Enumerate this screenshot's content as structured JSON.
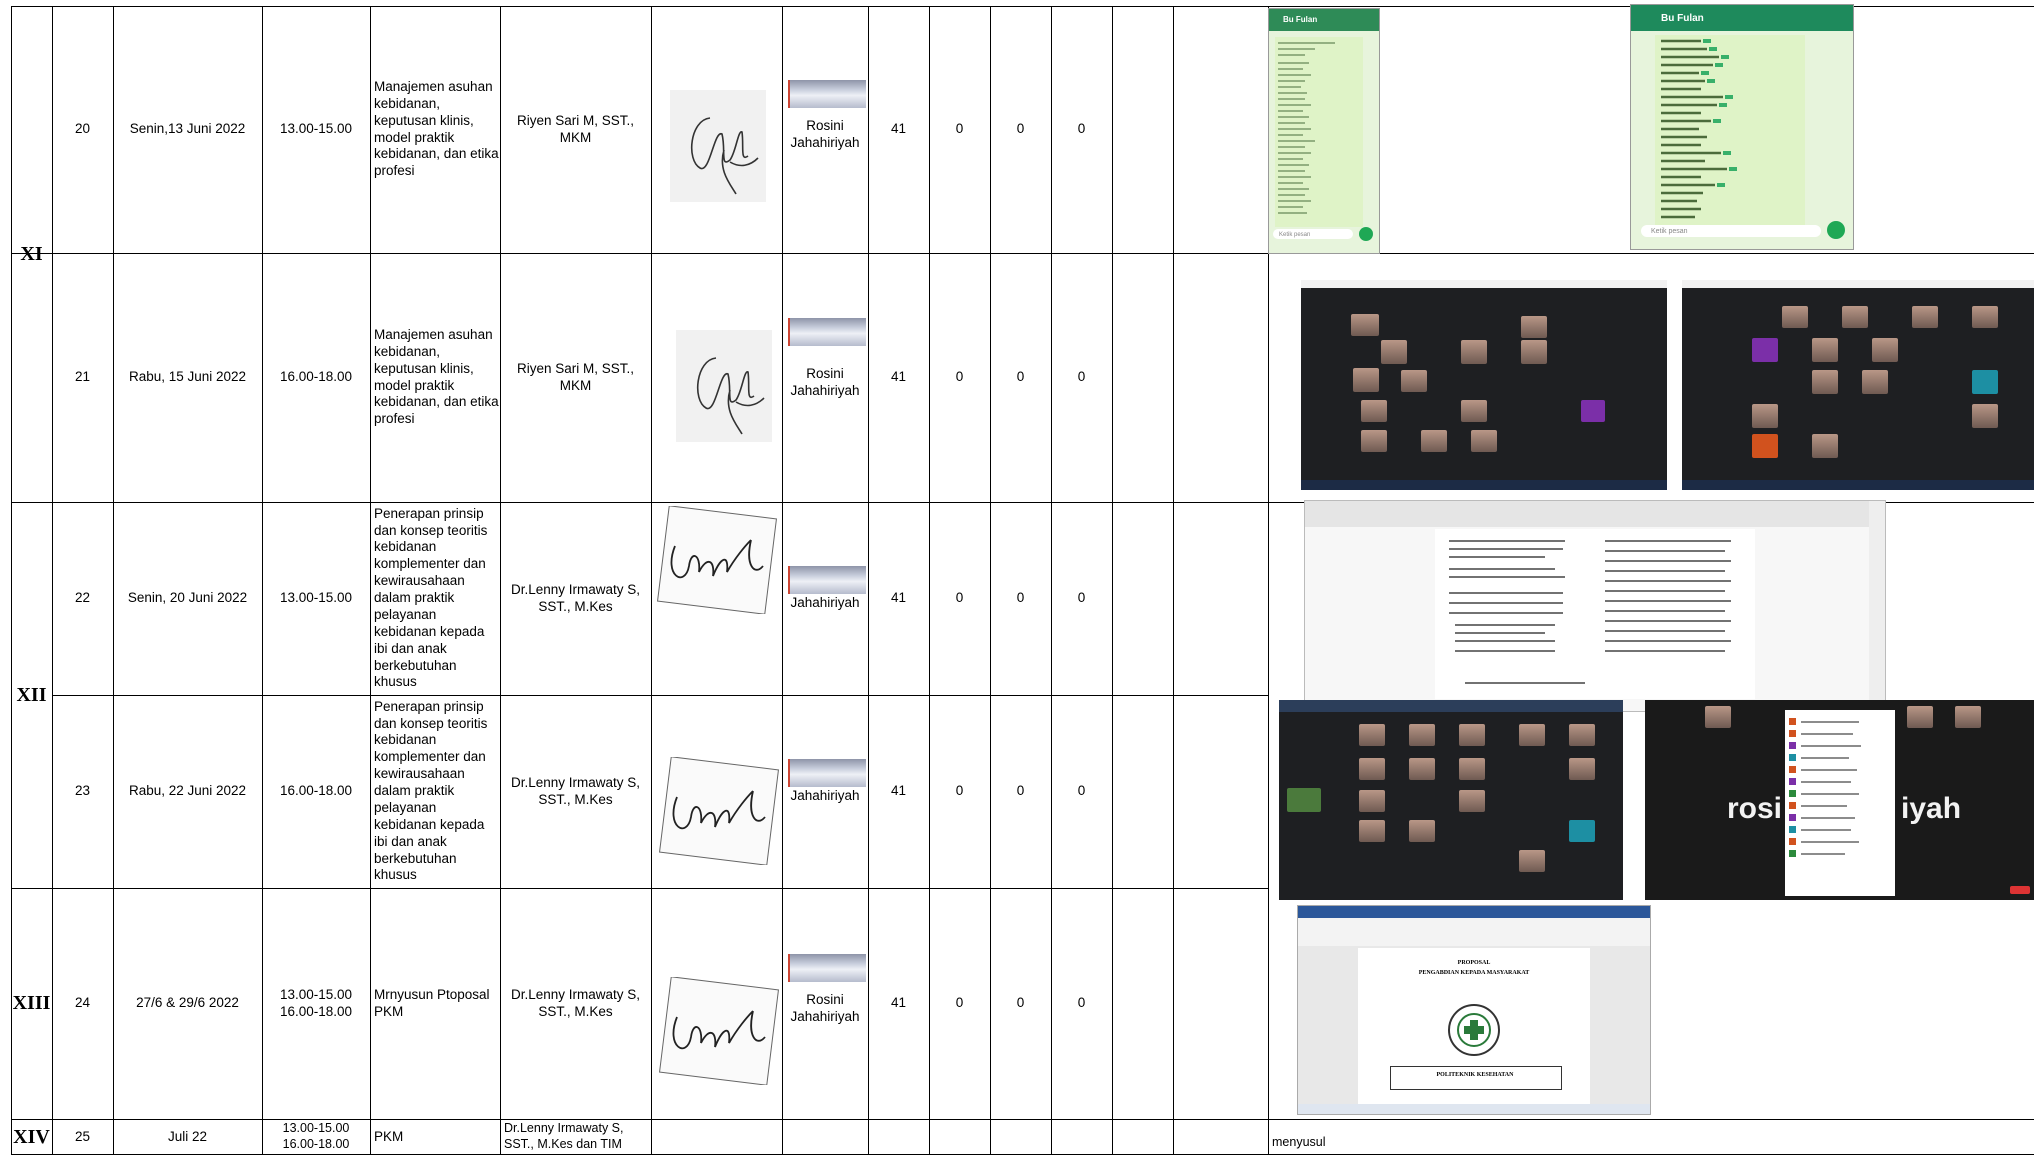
{
  "rows": [
    {
      "no": "20",
      "day": "Senin,13 Juni 2022",
      "time": "13.00-15.00",
      "topic": "Manajemen asuhan kebidanan, keputusan klinis, model praktik kebidanan, dan etika profesi",
      "lecturer": "Riyen Sari M, SST., MKM",
      "witness": "Rosini Jahahiriyah",
      "c1": "41",
      "c2": "0",
      "c3": "0",
      "c4": "0"
    },
    {
      "no": "21",
      "day": "Rabu, 15 Juni 2022",
      "time": "16.00-18.00",
      "topic": "Manajemen asuhan kebidanan, keputusan klinis, model praktik kebidanan, dan etika profesi",
      "lecturer": "Riyen Sari M, SST., MKM",
      "witness": "Rosini Jahahiriyah",
      "c1": "41",
      "c2": "0",
      "c3": "0",
      "c4": "0"
    },
    {
      "no": "22",
      "day": "Senin, 20 Juni 2022",
      "time": "13.00-15.00",
      "topic": "Penerapan prinsip dan konsep teoritis kebidanan komplementer dan kewirausahaan dalam praktik pelayanan kebidanan kepada ibi dan anak berkebutuhan khusus",
      "lecturer": "Dr.Lenny Irmawaty S, SST., M.Kes",
      "witness": "Jahahiriyah",
      "c1": "41",
      "c2": "0",
      "c3": "0",
      "c4": "0"
    },
    {
      "no": "23",
      "day": "Rabu, 22 Juni 2022",
      "time": "16.00-18.00",
      "topic": "Penerapan prinsip dan konsep teoritis kebidanan komplementer dan kewirausahaan dalam praktik pelayanan kebidanan kepada ibi dan anak berkebutuhan khusus",
      "lecturer": "Dr.Lenny Irmawaty S, SST., M.Kes",
      "witness": "Jahahiriyah",
      "c1": "41",
      "c2": "0",
      "c3": "0",
      "c4": "0"
    },
    {
      "no": "24",
      "day": "27/6 & 29/6 2022",
      "time": "13.00-15.00\n16.00-18.00",
      "topic": "Mrnyusun Ptoposal PKM",
      "lecturer": "Dr.Lenny Irmawaty S, SST., M.Kes",
      "witness": "Rosini Jahahiriyah",
      "c1": "41",
      "c2": "0",
      "c3": "0",
      "c4": "0"
    },
    {
      "no": "25",
      "day": "Juli 22",
      "time": "13.00-15.00\n16.00-18.00",
      "topic": "PKM",
      "lecturer": "Dr.Lenny Irmawaty S, SST., M.Kes dan TIM",
      "witness": "",
      "c1": "",
      "c2": "",
      "c3": "",
      "c4": ""
    }
  ],
  "groups": [
    "XI",
    "XII",
    "XIII",
    "XIV"
  ],
  "evidence_note": "menyusul",
  "screens": {
    "chat_left_header": "Bu Fulan",
    "chat_right_header": "Bu Fulan",
    "chat_input": "Ketik pesan",
    "doc_heading_1": "PROPOSAL",
    "doc_heading_2": "PENGABDIAN KEPADA MASYARAKAT",
    "doc_box_text": "POLITEKNIK KESEHATAN",
    "zoom_name_left": "rosi",
    "zoom_name_right": "iyah"
  }
}
